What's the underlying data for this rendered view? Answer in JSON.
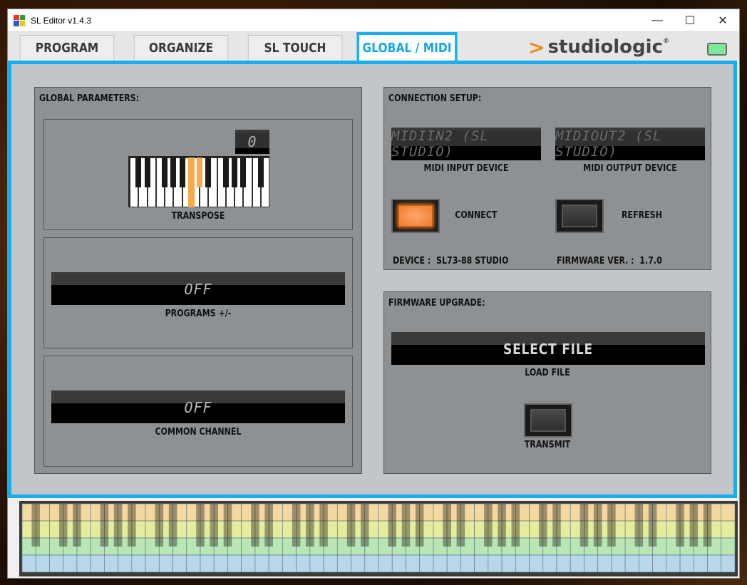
{
  "window": {
    "title": "SL Editor v1.4.3",
    "controls": {
      "minimize": "—",
      "maximize": "☐",
      "close": "✕"
    }
  },
  "tabs": [
    {
      "label": "PROGRAM"
    },
    {
      "label": "ORGANIZE"
    },
    {
      "label": "SL TOUCH"
    },
    {
      "label": "GLOBAL / MIDI"
    }
  ],
  "brand": {
    "arrow": ">",
    "name": "studiologic",
    "reg": "®"
  },
  "colors": {
    "accent": "#17aef0",
    "led": "#7de89a",
    "orange": "#f5a94a"
  },
  "global": {
    "title": "GLOBAL PARAMETERS:",
    "transpose": {
      "value": "0",
      "label": "TRANSPOSE"
    },
    "programs": {
      "value": "OFF",
      "label": "PROGRAMS +/-"
    },
    "common_channel": {
      "value": "OFF",
      "label": "COMMON CHANNEL"
    }
  },
  "connection": {
    "title": "CONNECTION SETUP:",
    "midi_in": {
      "value": "MIDIIN2 (SL STUDIO)",
      "label": "MIDI INPUT DEVICE"
    },
    "midi_out": {
      "value": "MIDIOUT2 (SL STUDIO)",
      "label": "MIDI OUTPUT DEVICE"
    },
    "connect_label": "CONNECT",
    "refresh_label": "REFRESH",
    "device_label": "DEVICE :",
    "device_value": "SL73-88 STUDIO",
    "firmware_label": "FIRMWARE VER. :",
    "firmware_value": "1.7.0"
  },
  "firmware": {
    "title": "FIRMWARE UPGRADE:",
    "select_file": "SELECT FILE",
    "load_label": "LOAD FILE",
    "transmit_label": "TRANSMIT"
  }
}
